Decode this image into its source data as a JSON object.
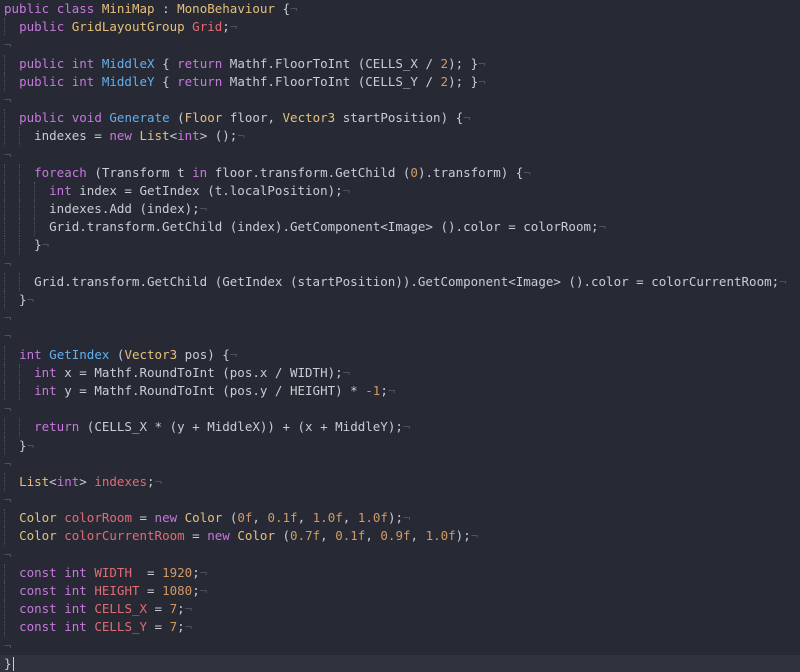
{
  "editor": {
    "language": "csharp",
    "colors": {
      "background": "#272a34",
      "current_line": "#2f333d",
      "keyword": "#c678dd",
      "type": "#e5c07b",
      "function": "#61afef",
      "number": "#d19a66",
      "variable": "#e06c75",
      "plain": "#c8ccd4",
      "invisible": "#4b5161"
    },
    "lines": [
      [
        [
          "kw",
          "public"
        ],
        [
          "p",
          " "
        ],
        [
          "kw",
          "class"
        ],
        [
          "p",
          " "
        ],
        [
          "type",
          "MiniMap"
        ],
        [
          "p",
          " : "
        ],
        [
          "type",
          "MonoBehaviour"
        ],
        [
          "p",
          " {"
        ],
        [
          "inv",
          "¬"
        ]
      ],
      [
        [
          "p",
          "  "
        ],
        [
          "kw",
          "public"
        ],
        [
          "p",
          " "
        ],
        [
          "type",
          "GridLayoutGroup"
        ],
        [
          "p",
          " "
        ],
        [
          "var",
          "Grid"
        ],
        [
          "p",
          ";"
        ],
        [
          "inv",
          "¬"
        ]
      ],
      [
        [
          "inv",
          "¬"
        ]
      ],
      [
        [
          "p",
          "  "
        ],
        [
          "kw",
          "public"
        ],
        [
          "p",
          " "
        ],
        [
          "kw",
          "int"
        ],
        [
          "p",
          " "
        ],
        [
          "fn",
          "MiddleX"
        ],
        [
          "p",
          " { "
        ],
        [
          "kw",
          "return"
        ],
        [
          "p",
          " Mathf.FloorToInt (CELLS_X / "
        ],
        [
          "num",
          "2"
        ],
        [
          "p",
          "); }"
        ],
        [
          "inv",
          "¬"
        ]
      ],
      [
        [
          "p",
          "  "
        ],
        [
          "kw",
          "public"
        ],
        [
          "p",
          " "
        ],
        [
          "kw",
          "int"
        ],
        [
          "p",
          " "
        ],
        [
          "fn",
          "MiddleY"
        ],
        [
          "p",
          " { "
        ],
        [
          "kw",
          "return"
        ],
        [
          "p",
          " Mathf.FloorToInt (CELLS_Y / "
        ],
        [
          "num",
          "2"
        ],
        [
          "p",
          "); }"
        ],
        [
          "inv",
          "¬"
        ]
      ],
      [
        [
          "inv",
          "¬"
        ]
      ],
      [
        [
          "p",
          "  "
        ],
        [
          "kw",
          "public"
        ],
        [
          "p",
          " "
        ],
        [
          "kw",
          "void"
        ],
        [
          "p",
          " "
        ],
        [
          "fn",
          "Generate"
        ],
        [
          "p",
          " ("
        ],
        [
          "type",
          "Floor"
        ],
        [
          "p",
          " floor, "
        ],
        [
          "type",
          "Vector3"
        ],
        [
          "p",
          " startPosition) {"
        ],
        [
          "inv",
          "¬"
        ]
      ],
      [
        [
          "p",
          "    indexes = "
        ],
        [
          "kw",
          "new"
        ],
        [
          "p",
          " "
        ],
        [
          "type",
          "List"
        ],
        [
          "p",
          "<"
        ],
        [
          "kw",
          "int"
        ],
        [
          "p",
          "> ();"
        ],
        [
          "inv",
          "¬"
        ]
      ],
      [
        [
          "inv",
          "¬"
        ]
      ],
      [
        [
          "p",
          "    "
        ],
        [
          "kw",
          "foreach"
        ],
        [
          "p",
          " (Transform t "
        ],
        [
          "kw",
          "in"
        ],
        [
          "p",
          " floor.transform.GetChild ("
        ],
        [
          "num",
          "0"
        ],
        [
          "p",
          ").transform) {"
        ],
        [
          "inv",
          "¬"
        ]
      ],
      [
        [
          "p",
          "      "
        ],
        [
          "kw",
          "int"
        ],
        [
          "p",
          " index = GetIndex (t.localPosition);"
        ],
        [
          "inv",
          "¬"
        ]
      ],
      [
        [
          "p",
          "      indexes.Add (index);"
        ],
        [
          "inv",
          "¬"
        ]
      ],
      [
        [
          "p",
          "      Grid.transform.GetChild (index).GetComponent<Image> ().color = colorRoom;"
        ],
        [
          "inv",
          "¬"
        ]
      ],
      [
        [
          "p",
          "    }"
        ],
        [
          "inv",
          "¬"
        ]
      ],
      [
        [
          "inv",
          "¬"
        ]
      ],
      [
        [
          "p",
          "    Grid.transform.GetChild (GetIndex (startPosition)).GetComponent<Image> ().color = colorCurrentRoom;"
        ],
        [
          "inv",
          "¬"
        ]
      ],
      [
        [
          "p",
          "  }"
        ],
        [
          "inv",
          "¬"
        ]
      ],
      [
        [
          "inv",
          "¬"
        ]
      ],
      [
        [
          "inv",
          "¬"
        ]
      ],
      [
        [
          "p",
          "  "
        ],
        [
          "kw",
          "int"
        ],
        [
          "p",
          " "
        ],
        [
          "fn",
          "GetIndex"
        ],
        [
          "p",
          " ("
        ],
        [
          "type",
          "Vector3"
        ],
        [
          "p",
          " pos) {"
        ],
        [
          "inv",
          "¬"
        ]
      ],
      [
        [
          "p",
          "    "
        ],
        [
          "kw",
          "int"
        ],
        [
          "p",
          " x = Mathf.RoundToInt (pos.x / WIDTH);"
        ],
        [
          "inv",
          "¬"
        ]
      ],
      [
        [
          "p",
          "    "
        ],
        [
          "kw",
          "int"
        ],
        [
          "p",
          " y = Mathf.RoundToInt (pos.y / HEIGHT) * "
        ],
        [
          "num",
          "-1"
        ],
        [
          "p",
          ";"
        ],
        [
          "inv",
          "¬"
        ]
      ],
      [
        [
          "inv",
          "¬"
        ]
      ],
      [
        [
          "p",
          "    "
        ],
        [
          "kw",
          "return"
        ],
        [
          "p",
          " (CELLS_X * (y + MiddleX)) + (x + MiddleY);"
        ],
        [
          "inv",
          "¬"
        ]
      ],
      [
        [
          "p",
          "  }"
        ],
        [
          "inv",
          "¬"
        ]
      ],
      [
        [
          "inv",
          "¬"
        ]
      ],
      [
        [
          "p",
          "  "
        ],
        [
          "type",
          "List"
        ],
        [
          "p",
          "<"
        ],
        [
          "kw",
          "int"
        ],
        [
          "p",
          "> "
        ],
        [
          "var",
          "indexes"
        ],
        [
          "p",
          ";"
        ],
        [
          "inv",
          "¬"
        ]
      ],
      [
        [
          "inv",
          "¬"
        ]
      ],
      [
        [
          "p",
          "  "
        ],
        [
          "type",
          "Color"
        ],
        [
          "p",
          " "
        ],
        [
          "var",
          "colorRoom"
        ],
        [
          "p",
          " = "
        ],
        [
          "kw",
          "new"
        ],
        [
          "p",
          " "
        ],
        [
          "type",
          "Color"
        ],
        [
          "p",
          " ("
        ],
        [
          "num",
          "0f"
        ],
        [
          "p",
          ", "
        ],
        [
          "num",
          "0.1f"
        ],
        [
          "p",
          ", "
        ],
        [
          "num",
          "1.0f"
        ],
        [
          "p",
          ", "
        ],
        [
          "num",
          "1.0f"
        ],
        [
          "p",
          ");"
        ],
        [
          "inv",
          "¬"
        ]
      ],
      [
        [
          "p",
          "  "
        ],
        [
          "type",
          "Color"
        ],
        [
          "p",
          " "
        ],
        [
          "var",
          "colorCurrentRoom"
        ],
        [
          "p",
          " = "
        ],
        [
          "kw",
          "new"
        ],
        [
          "p",
          " "
        ],
        [
          "type",
          "Color"
        ],
        [
          "p",
          " ("
        ],
        [
          "num",
          "0.7f"
        ],
        [
          "p",
          ", "
        ],
        [
          "num",
          "0.1f"
        ],
        [
          "p",
          ", "
        ],
        [
          "num",
          "0.9f"
        ],
        [
          "p",
          ", "
        ],
        [
          "num",
          "1.0f"
        ],
        [
          "p",
          ");"
        ],
        [
          "inv",
          "¬"
        ]
      ],
      [
        [
          "inv",
          "¬"
        ]
      ],
      [
        [
          "p",
          "  "
        ],
        [
          "kw",
          "const"
        ],
        [
          "p",
          " "
        ],
        [
          "kw",
          "int"
        ],
        [
          "p",
          " "
        ],
        [
          "var",
          "WIDTH"
        ],
        [
          "p",
          "  = "
        ],
        [
          "num",
          "1920"
        ],
        [
          "p",
          ";"
        ],
        [
          "inv",
          "¬"
        ]
      ],
      [
        [
          "p",
          "  "
        ],
        [
          "kw",
          "const"
        ],
        [
          "p",
          " "
        ],
        [
          "kw",
          "int"
        ],
        [
          "p",
          " "
        ],
        [
          "var",
          "HEIGHT"
        ],
        [
          "p",
          " = "
        ],
        [
          "num",
          "1080"
        ],
        [
          "p",
          ";"
        ],
        [
          "inv",
          "¬"
        ]
      ],
      [
        [
          "p",
          "  "
        ],
        [
          "kw",
          "const"
        ],
        [
          "p",
          " "
        ],
        [
          "kw",
          "int"
        ],
        [
          "p",
          " "
        ],
        [
          "var",
          "CELLS_X"
        ],
        [
          "p",
          " = "
        ],
        [
          "num",
          "7"
        ],
        [
          "p",
          ";"
        ],
        [
          "inv",
          "¬"
        ]
      ],
      [
        [
          "p",
          "  "
        ],
        [
          "kw",
          "const"
        ],
        [
          "p",
          " "
        ],
        [
          "kw",
          "int"
        ],
        [
          "p",
          " "
        ],
        [
          "var",
          "CELLS_Y"
        ],
        [
          "p",
          " = "
        ],
        [
          "num",
          "7"
        ],
        [
          "p",
          ";"
        ],
        [
          "inv",
          "¬"
        ]
      ],
      [
        [
          "inv",
          "¬"
        ]
      ],
      [
        [
          "p",
          "}"
        ]
      ]
    ],
    "current_line": 36
  }
}
